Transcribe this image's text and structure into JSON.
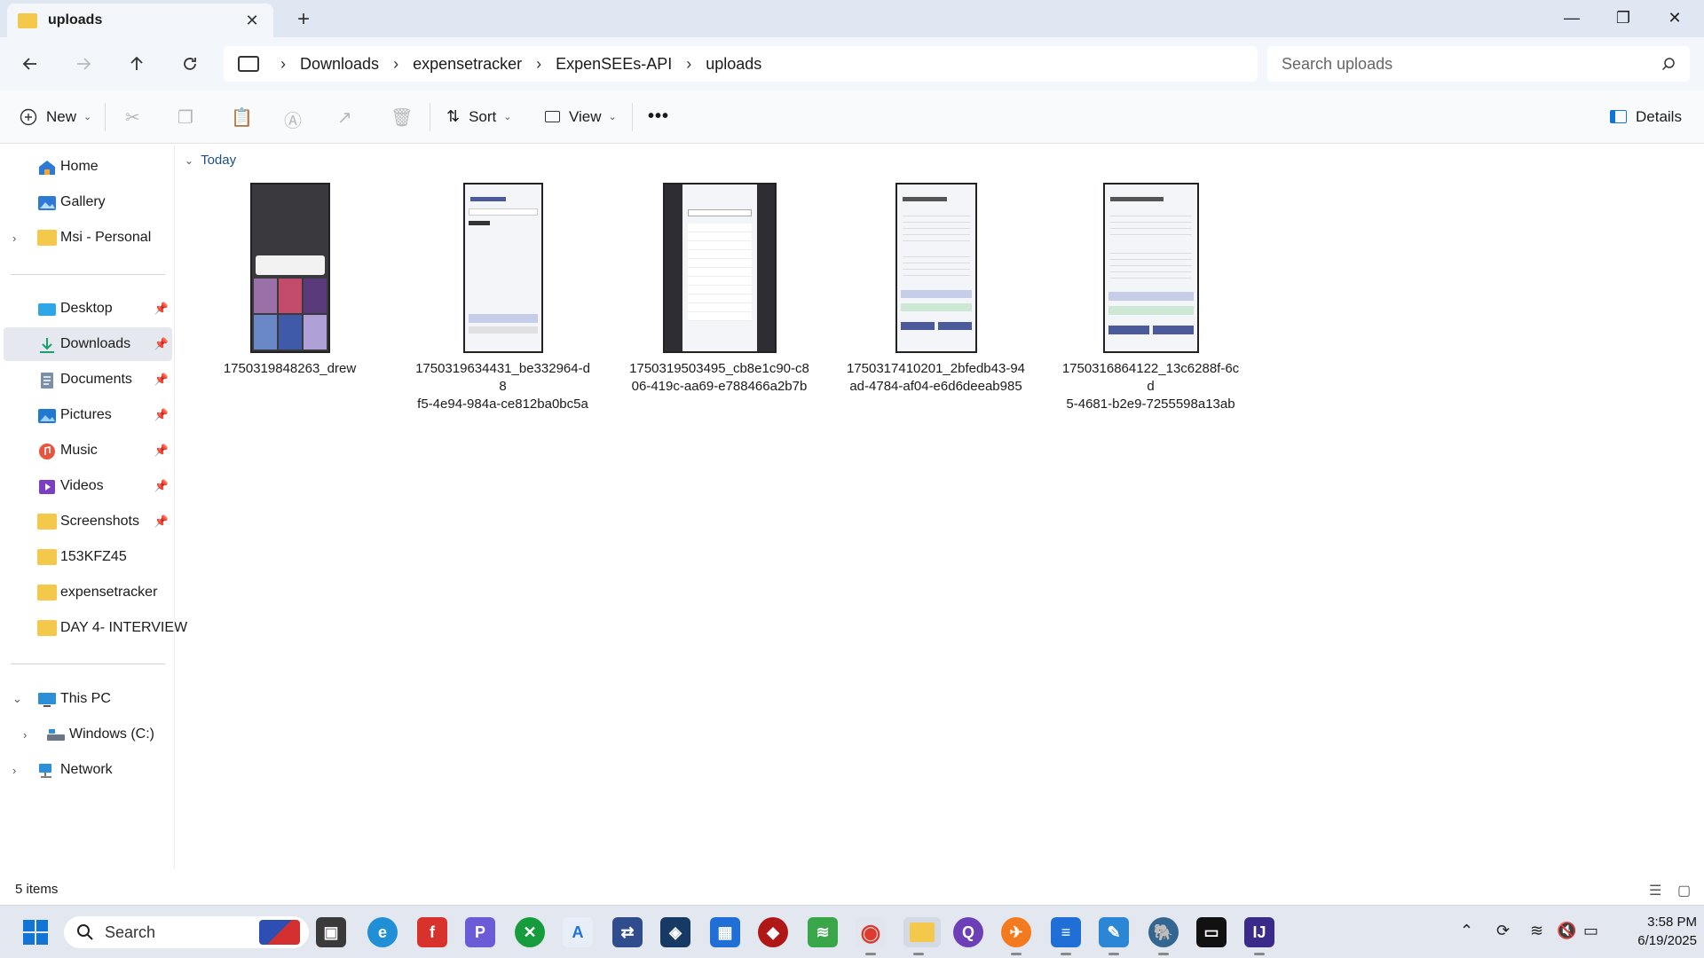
{
  "window": {
    "tab_title": "uploads",
    "new_tab": "+",
    "close_tab": "✕",
    "minimize": "—",
    "restore": "❐",
    "close": "✕"
  },
  "nav": {
    "back_icon": "arrow-left",
    "forward_icon": "arrow-right",
    "up_icon": "arrow-up",
    "refresh_icon": "refresh",
    "breadcrumb": [
      "Downloads",
      "expensetracker",
      "ExpenSEEs-API",
      "uploads"
    ],
    "search_placeholder": "Search uploads"
  },
  "toolbar": {
    "new_label": "New",
    "sort_label": "Sort",
    "view_label": "View",
    "more_label": "•••",
    "details_label": "Details"
  },
  "sidebar": {
    "top_items": [
      {
        "label": "Home",
        "icon": "home-icon"
      },
      {
        "label": "Gallery",
        "icon": "gallery-icon"
      },
      {
        "label": "Msi - Personal",
        "icon": "folder-icon"
      }
    ],
    "quick_access": [
      {
        "label": "Desktop",
        "icon": "desktop-icon",
        "pinned": true
      },
      {
        "label": "Downloads",
        "icon": "download-icon",
        "pinned": true
      },
      {
        "label": "Documents",
        "icon": "documents-icon",
        "pinned": true
      },
      {
        "label": "Pictures",
        "icon": "pictures-icon",
        "pinned": true
      },
      {
        "label": "Music",
        "icon": "music-icon",
        "pinned": true
      },
      {
        "label": "Videos",
        "icon": "videos-icon",
        "pinned": true
      },
      {
        "label": "Screenshots",
        "icon": "folder-icon",
        "pinned": true
      },
      {
        "label": "153KFZ45",
        "icon": "folder-icon",
        "pinned": false
      },
      {
        "label": "expensetracker",
        "icon": "folder-icon",
        "pinned": false
      },
      {
        "label": "DAY 4- INTERVIEW",
        "icon": "folder-icon",
        "pinned": false
      }
    ],
    "this_pc": "This PC",
    "windows_c": "Windows (C:)",
    "network": "Network"
  },
  "content": {
    "group": "Today",
    "files": [
      {
        "name_line1": "1750319848263_drew",
        "name_line2": ""
      },
      {
        "name_line1": "1750319634431_be332964-d8",
        "name_line2": "f5-4e94-984a-ce812ba0bc5a"
      },
      {
        "name_line1": "1750319503495_cb8e1c90-c8",
        "name_line2": "06-419c-aa69-e788466a2b7b"
      },
      {
        "name_line1": "1750317410201_2bfedb43-94",
        "name_line2": "ad-4784-af04-e6d6deeab985"
      },
      {
        "name_line1": "1750316864122_13c6288f-6cd",
        "name_line2": "5-4681-b2e9-7255598a13ab"
      }
    ]
  },
  "status": {
    "item_count": "5 items"
  },
  "taskbar": {
    "search_label": "Search",
    "time": "3:58 PM",
    "date": "6/19/2025"
  },
  "colors": {
    "accent": "#1374d8",
    "folder": "#f4c84a",
    "selected": "#e5e8ee"
  }
}
